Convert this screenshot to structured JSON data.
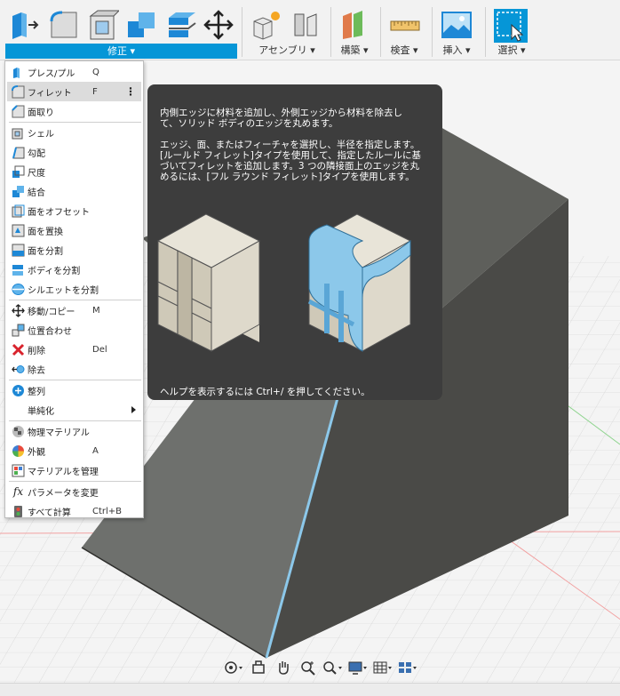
{
  "toolbar": {
    "modify_label": "修正 ▾",
    "assemble_label": "アセンブリ ▾",
    "construct_label": "構築 ▾",
    "inspect_label": "検査 ▾",
    "insert_label": "挿入 ▾",
    "select_label": "選択 ▾"
  },
  "menu": {
    "items": [
      {
        "label": "プレス/プル",
        "shortcut": "Q",
        "icon": "press-pull-icon"
      },
      {
        "label": "フィレット",
        "shortcut": "F",
        "icon": "fillet-icon"
      },
      {
        "label": "面取り",
        "shortcut": "",
        "icon": "chamfer-icon"
      },
      {
        "label": "シェル",
        "shortcut": "",
        "icon": "shell-icon"
      },
      {
        "label": "勾配",
        "shortcut": "",
        "icon": "draft-icon"
      },
      {
        "label": "尺度",
        "shortcut": "",
        "icon": "scale-icon"
      },
      {
        "label": "結合",
        "shortcut": "",
        "icon": "combine-icon"
      },
      {
        "label": "面をオフセット",
        "shortcut": "",
        "icon": "offset-face-icon"
      },
      {
        "label": "面を置換",
        "shortcut": "",
        "icon": "replace-face-icon"
      },
      {
        "label": "面を分割",
        "shortcut": "",
        "icon": "split-face-icon"
      },
      {
        "label": "ボディを分割",
        "shortcut": "",
        "icon": "split-body-icon"
      },
      {
        "label": "シルエットを分割",
        "shortcut": "",
        "icon": "silhouette-split-icon"
      },
      {
        "label": "移動/コピー",
        "shortcut": "M",
        "icon": "move-icon"
      },
      {
        "label": "位置合わせ",
        "shortcut": "",
        "icon": "align-icon"
      },
      {
        "label": "削除",
        "shortcut": "Del",
        "icon": "delete-icon"
      },
      {
        "label": "除去",
        "shortcut": "",
        "icon": "remove-icon"
      },
      {
        "label": "整列",
        "shortcut": "",
        "icon": "arrange-icon"
      },
      {
        "label": "単純化",
        "shortcut": "",
        "icon": ""
      },
      {
        "label": "物理マテリアル",
        "shortcut": "",
        "icon": "physical-material-icon"
      },
      {
        "label": "外観",
        "shortcut": "A",
        "icon": "appearance-icon"
      },
      {
        "label": "マテリアルを管理",
        "shortcut": "",
        "icon": "manage-materials-icon"
      },
      {
        "label": "パラメータを変更",
        "shortcut": "",
        "icon": "parameters-icon"
      },
      {
        "label": "すべて計算",
        "shortcut": "Ctrl+B",
        "icon": "compute-all-icon"
      }
    ],
    "more_glyph": "⋮",
    "fx_glyph": "fx"
  },
  "tooltip": {
    "para1": "内側エッジに材料を追加し、外側エッジから材料を除去し\nて、ソリッド ボディのエッジを丸めます。",
    "para2": "エッジ、面、またはフィーチャを選択し、半径を指定します。\n[ルールド フィレット]タイプを使用して、指定したルールに基\nづいてフィレットを追加します。3 つの隣接面上のエッジを丸\nめるには、[フル ラウンド フィレット]タイプを使用します。",
    "help": "ヘルプを表示するには Ctrl+/ を押してください。"
  },
  "colors": {
    "accent": "#0696d7",
    "body_dark": "#4a4a47",
    "body_light": "#6e706d",
    "tooltip_bg": "#3d3d3d",
    "fillet_blue": "#8cc8ea"
  }
}
